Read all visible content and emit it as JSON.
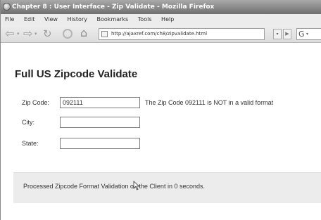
{
  "window": {
    "title": "Chapter 8 : User Interface - Zip Validate - Mozilla Firefox"
  },
  "menubar": {
    "items": [
      "File",
      "Edit",
      "View",
      "History",
      "Bookmarks",
      "Tools",
      "Help"
    ]
  },
  "toolbar": {
    "url": "http://ajaxref.com/ch8/zipvalidate.html",
    "icons": [
      "back-icon",
      "forward-icon",
      "reload-icon",
      "stop-icon",
      "home-icon",
      "favicon-icon",
      "dropdown-icon",
      "go-icon",
      "search-engine-icon"
    ]
  },
  "page": {
    "title": "Full US Zipcode Validate",
    "form": {
      "zip_label": "Zip Code:",
      "zip_value": "092111",
      "city_label": "City:",
      "city_value": "",
      "state_label": "State:",
      "state_value": ""
    },
    "validation_message": "The Zip Code 092111 is NOT in a valid format",
    "status_message": "Processed Zipcode Format Validation on the Client in 0 seconds."
  }
}
